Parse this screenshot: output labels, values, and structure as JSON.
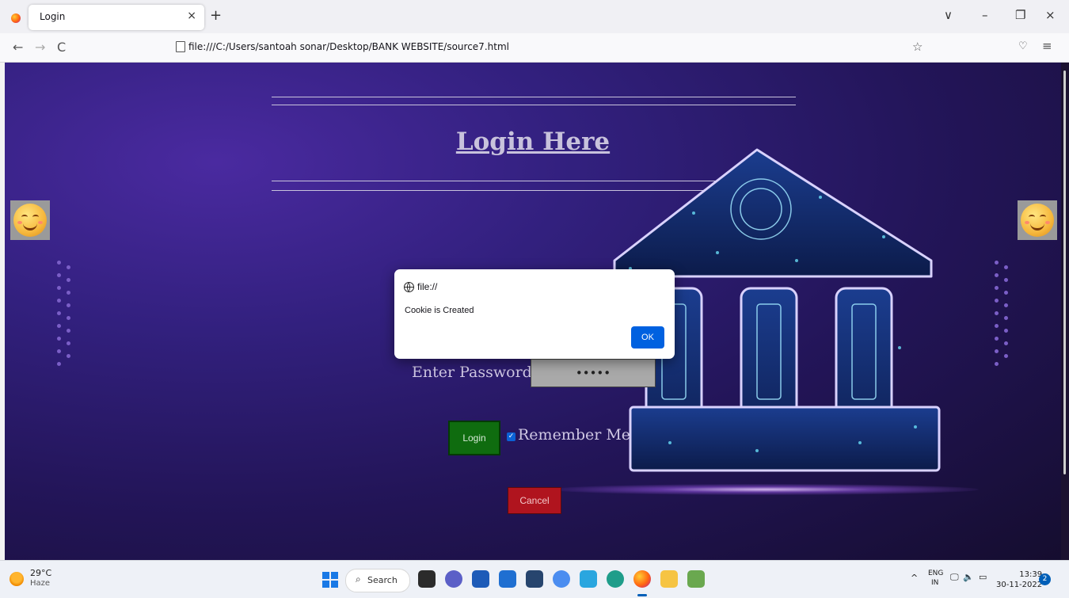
{
  "browser": {
    "tab_title": "Login",
    "tab_close": "×",
    "new_tab": "+",
    "url": "file:///C:/Users/santoah sonar/Desktop/BANK WEBSITE/source7.html",
    "back": "←",
    "forward": "→",
    "reload": "C",
    "bookmark_star": "☆",
    "pocket": "♡",
    "menu": "≡",
    "win_list": "∨",
    "win_minimize": "–",
    "win_restore": "❐",
    "win_close": "×"
  },
  "page": {
    "heading": "Login Here",
    "password_label": "Enter Password:",
    "password_value": "•••••",
    "login_button": "Login",
    "remember_label": "Remember Me",
    "remember_checked": true,
    "cancel_button": "Cancel"
  },
  "dialog": {
    "origin": "file://",
    "message": "Cookie is Created",
    "ok_button": "OK"
  },
  "taskbar": {
    "temperature": "29°C",
    "condition": "Haze",
    "search_label": "Search",
    "tray_chevron": "^",
    "lang_top": "ENG",
    "lang_bottom": "IN",
    "time": "13:39",
    "date": "30-11-2022",
    "notification_count": "2"
  },
  "colors": {
    "login_green": "#0f6c0f",
    "cancel_red": "#b0141e",
    "ok_blue": "#0061e0",
    "page_purple": "#32207e"
  }
}
